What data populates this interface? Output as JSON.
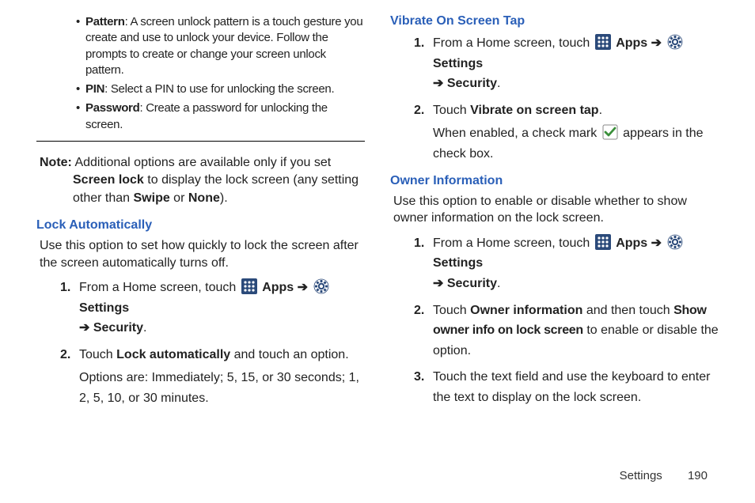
{
  "col1": {
    "bullets": [
      {
        "term": "Pattern",
        "desc": ": A screen unlock pattern is a touch gesture you create and use to unlock your device. Follow the prompts to create or change your screen unlock pattern."
      },
      {
        "term": "PIN",
        "desc": ": Select a PIN to use for unlocking the screen."
      },
      {
        "term": "Password",
        "desc": ": Create a password for unlocking the screen."
      }
    ],
    "note": {
      "label": "Note:",
      "t1": "Additional options are available only if you set ",
      "b1": "Screen lock",
      "t2": " to display the lock screen (any setting other than ",
      "b2": "Swipe",
      "t3": " or ",
      "b3": "None",
      "t4": ")."
    },
    "lockAuto": {
      "heading": "Lock Automatically",
      "intro": "Use this option to set how quickly to lock the screen after the screen automatically turns off.",
      "step1": {
        "t1": "From a Home screen, touch ",
        "apps": "Apps",
        "arrow": " ➔ ",
        "settings": "Settings",
        "arrow2": "➔ ",
        "security": "Security",
        "end": "."
      },
      "step2": {
        "t1": "Touch ",
        "b1": "Lock automatically",
        "t2": " and touch an option.",
        "sub": "Options are: Immediately; 5, 15, or 30 seconds; 1, 2, 5, 10, or 30 minutes."
      }
    }
  },
  "col2": {
    "vibrate": {
      "heading": "Vibrate On Screen Tap",
      "step1": {
        "t1": "From a Home screen, touch ",
        "apps": "Apps",
        "arrow": " ➔ ",
        "settings": "Settings",
        "arrow2": "➔ ",
        "security": "Security",
        "end": "."
      },
      "step2": {
        "t1": "Touch ",
        "b1": "Vibrate on screen tap",
        "t2": ".",
        "sub1": "When enabled, a check mark ",
        "sub2": " appears in the check box."
      }
    },
    "owner": {
      "heading": "Owner Information",
      "intro": "Use this option to enable or disable whether to show owner information on the lock screen.",
      "step1": {
        "t1": "From a Home screen, touch ",
        "apps": "Apps",
        "arrow": " ➔ ",
        "settings": "Settings",
        "arrow2": "➔ ",
        "security": "Security",
        "end": "."
      },
      "step2": {
        "t1": "Touch ",
        "b1": "Owner information",
        "t2": " and then touch ",
        "b2": "Show owner info on lock screen",
        "t3": " to enable or disable the option."
      },
      "step3": {
        "t1": "Touch the text field and use the keyboard to enter the text to display on the lock screen."
      }
    }
  },
  "footer": {
    "section": "Settings",
    "page": "190"
  }
}
